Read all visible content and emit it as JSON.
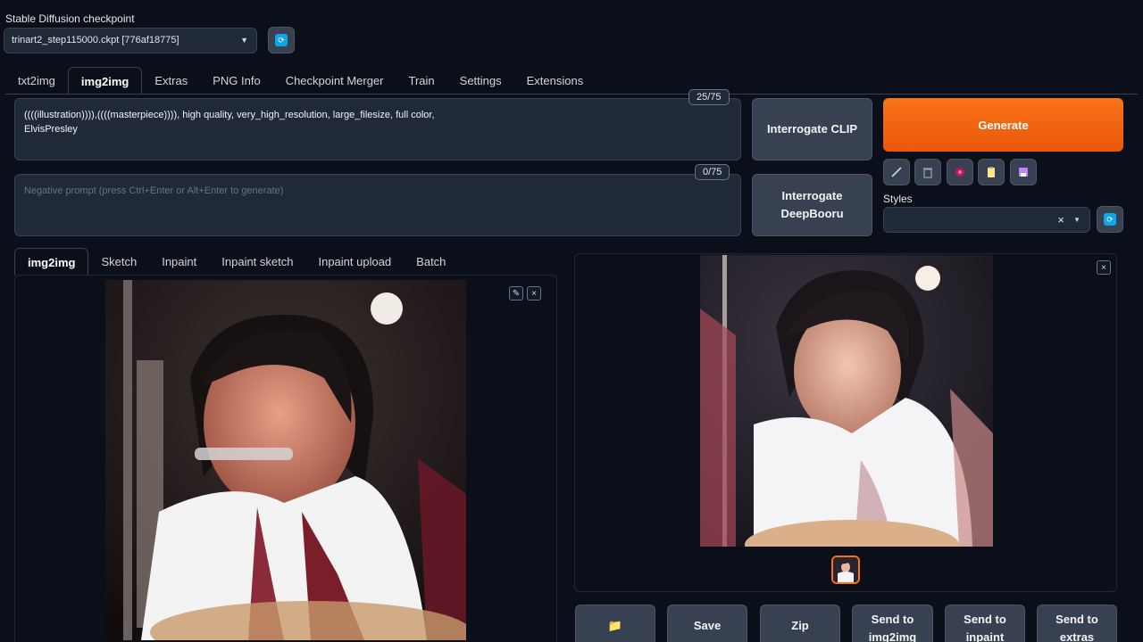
{
  "checkpoint": {
    "label": "Stable Diffusion checkpoint",
    "value": "trinart2_step115000.ckpt [776af18775]"
  },
  "tabs": [
    "txt2img",
    "img2img",
    "Extras",
    "PNG Info",
    "Checkpoint Merger",
    "Train",
    "Settings",
    "Extensions"
  ],
  "active_tab": "img2img",
  "prompt": {
    "text_line1": "((((illustration)))),((((masterpiece)))), high quality, very_high_resolution, large_filesize, full color,",
    "text_line2": "ElvisPresley",
    "counter": "25/75"
  },
  "negative_prompt": {
    "placeholder": "Negative prompt (press Ctrl+Enter or Alt+Enter to generate)",
    "counter": "0/75"
  },
  "buttons": {
    "interrogate_clip": "Interrogate CLIP",
    "interrogate_deepbooru_l1": "Interrogate",
    "interrogate_deepbooru_l2": "DeepBooru",
    "generate": "Generate"
  },
  "tool_icons": [
    "brush-icon",
    "trash-icon",
    "style-icon",
    "clipboard-icon",
    "save-disk-icon"
  ],
  "styles": {
    "label": "Styles",
    "clear": "×"
  },
  "subtabs": [
    "img2img",
    "Sketch",
    "Inpaint",
    "Inpaint sketch",
    "Inpaint upload",
    "Batch"
  ],
  "active_subtab": "img2img",
  "output_actions": [
    {
      "name": "open-folder-button",
      "l1": "📁",
      "l2": ""
    },
    {
      "name": "save-button",
      "l1": "Save",
      "l2": ""
    },
    {
      "name": "zip-button",
      "l1": "Zip",
      "l2": ""
    },
    {
      "name": "send-to-img2img-button",
      "l1": "Send to",
      "l2": "img2img"
    },
    {
      "name": "send-to-inpaint-button",
      "l1": "Send to",
      "l2": "inpaint"
    },
    {
      "name": "send-to-extras-button",
      "l1": "Send to",
      "l2": "extras"
    }
  ],
  "colors": {
    "background": "#0b0f19",
    "accent": "#f97316",
    "refresh": "#0ea5e9"
  }
}
